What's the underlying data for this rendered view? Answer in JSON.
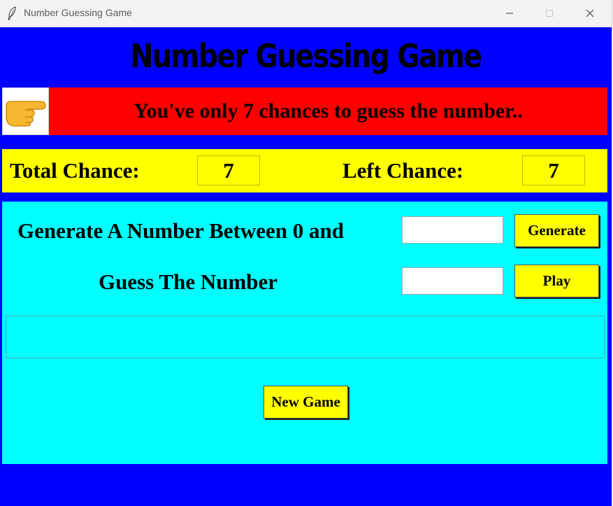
{
  "window": {
    "title": "Number Guessing Game",
    "icon": "feather-icon",
    "controls": [
      "minimize-icon",
      "maximize-icon",
      "close-icon"
    ]
  },
  "game": {
    "title": "Number Guessing Game",
    "hint_icon": "pointing-hand-icon",
    "hint_text": "You've only 7 chances to guess the number..",
    "total_chance_label": "Total Chance:",
    "total_chance_value": "7",
    "left_chance_label": "Left Chance:",
    "left_chance_value": "7",
    "generate_label": "Generate A Number Between 0 and",
    "generate_input_value": "",
    "generate_button": "Generate",
    "guess_label": "Guess The Number",
    "guess_input_value": "",
    "play_button": "Play",
    "result_text": "",
    "new_game_button": "New Game"
  },
  "colors": {
    "background": "#0000ff",
    "hint_bar": "#ff0000",
    "chance_bar": "#ffff00",
    "panel": "#00ffff",
    "button": "#ffff00"
  }
}
